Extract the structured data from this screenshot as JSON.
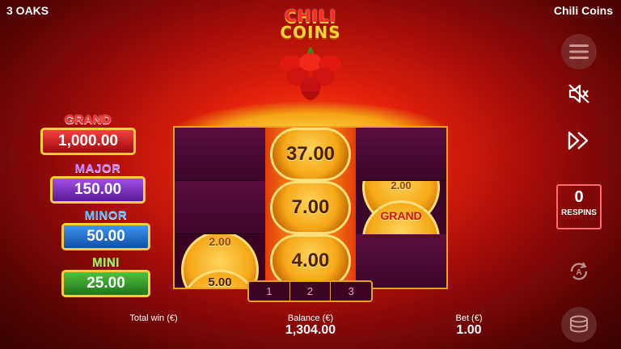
{
  "header": {
    "provider": "3 OAKS",
    "game_title": "Chili Coins"
  },
  "logo": {
    "line1": "CHILI",
    "line2": "COINS"
  },
  "jackpots": [
    {
      "name": "GRAND",
      "value": "1,000.00"
    },
    {
      "name": "MAJOR",
      "value": "150.00"
    },
    {
      "name": "MINOR",
      "value": "50.00"
    },
    {
      "name": "MINI",
      "value": "25.00"
    }
  ],
  "reels": {
    "coins": {
      "top": "37.00",
      "middle": "7.00",
      "bottom": "4.00"
    },
    "partial_left": "5.00",
    "partial_left_top": "2.00",
    "partial_right_top": "2.00",
    "partial_right_label": "GRAND"
  },
  "row_selector": [
    "1",
    "2",
    "3"
  ],
  "respins": {
    "count": "0",
    "label": "RESPINS"
  },
  "icons": {
    "menu": "hamburger-icon",
    "sound": "speaker-muted-icon",
    "turbo": "fast-forward-icon",
    "auto": "autoplay-icon",
    "bet": "coin-stack-icon"
  },
  "bottom": {
    "total_win_label": "Total win (€)",
    "balance_label": "Balance (€)",
    "balance_value": "1,304.00",
    "bet_label": "Bet (€)",
    "bet_value": "1.00"
  }
}
